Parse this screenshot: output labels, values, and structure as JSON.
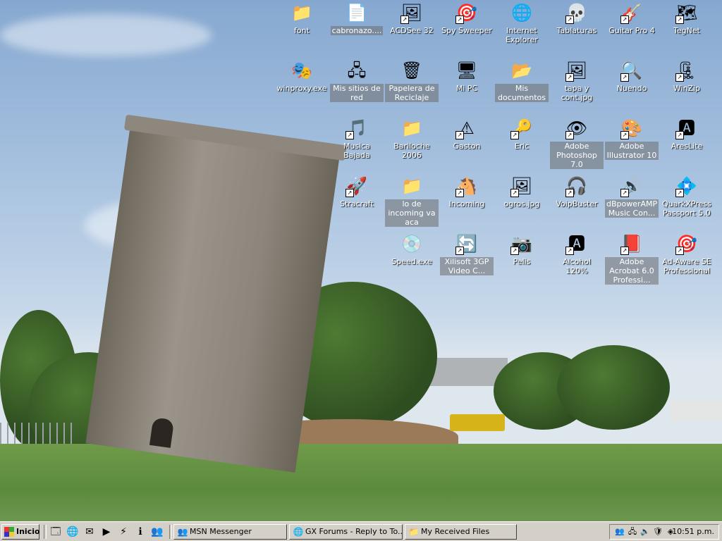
{
  "desktop": {
    "icons": [
      {
        "label": "font",
        "icon": "folder-icon",
        "glyph": "📁",
        "shortcut": false,
        "shaded": false
      },
      {
        "label": "cabronazo....",
        "icon": "document-icon",
        "glyph": "📄",
        "shortcut": false,
        "shaded": true
      },
      {
        "label": "ACDSee 32",
        "icon": "acdsee-icon",
        "glyph": "🖼",
        "shortcut": true,
        "shaded": false
      },
      {
        "label": "Spy Sweeper",
        "icon": "spy-sweeper-icon",
        "glyph": "🎯",
        "shortcut": true,
        "shaded": false
      },
      {
        "label": "Internet Explorer",
        "icon": "internet-explorer-icon",
        "glyph": "🌐",
        "shortcut": false,
        "shaded": false
      },
      {
        "label": "Tablaturas",
        "icon": "tablaturas-icon",
        "glyph": "💀",
        "shortcut": true,
        "shaded": false
      },
      {
        "label": "Guitar Pro 4",
        "icon": "guitar-pro-icon",
        "glyph": "🎸",
        "shortcut": true,
        "shaded": false
      },
      {
        "label": "TegNet",
        "icon": "tegnet-icon",
        "glyph": "🗺",
        "shortcut": true,
        "shaded": false
      },
      {
        "label": "winproxy.exe",
        "icon": "winproxy-icon",
        "glyph": "🎭",
        "shortcut": false,
        "shaded": false
      },
      {
        "label": "Mis sitios de red",
        "icon": "network-places-icon",
        "glyph": "🖧",
        "shortcut": false,
        "shaded": true
      },
      {
        "label": "Papelera de Reciclaje",
        "icon": "recycle-bin-icon",
        "glyph": "🗑",
        "shortcut": false,
        "shaded": true
      },
      {
        "label": "Mi PC",
        "icon": "my-computer-icon",
        "glyph": "🖥",
        "shortcut": false,
        "shaded": false
      },
      {
        "label": "Mis documentos",
        "icon": "my-documents-icon",
        "glyph": "📂",
        "shortcut": false,
        "shaded": true
      },
      {
        "label": "tapa y cont.jpg",
        "icon": "jpg-file-icon",
        "glyph": "🖼",
        "shortcut": true,
        "shaded": false
      },
      {
        "label": "Nuendo",
        "icon": "nuendo-icon",
        "glyph": "🔍",
        "shortcut": true,
        "shaded": false
      },
      {
        "label": "WinZip",
        "icon": "winzip-icon",
        "glyph": "🗜",
        "shortcut": true,
        "shaded": false
      },
      {
        "label": "Musica Bajada",
        "icon": "musica-bajada-icon",
        "glyph": "🎵",
        "shortcut": true,
        "shaded": false
      },
      {
        "label": "Bariloche 2006",
        "icon": "folder-icon",
        "glyph": "📁",
        "shortcut": false,
        "shaded": false
      },
      {
        "label": "Gaston",
        "icon": "warning-icon",
        "glyph": "⚠",
        "shortcut": true,
        "shaded": false
      },
      {
        "label": "Eric",
        "icon": "eric-icon",
        "glyph": "🔑",
        "shortcut": true,
        "shaded": false
      },
      {
        "label": "Adobe Photoshop 7.0",
        "icon": "photoshop-icon",
        "glyph": "👁",
        "shortcut": true,
        "shaded": true
      },
      {
        "label": "Adobe Illustrator 10",
        "icon": "illustrator-icon",
        "glyph": "🎨",
        "shortcut": true,
        "shaded": true
      },
      {
        "label": "AresLite",
        "icon": "areslite-icon",
        "glyph": "🅰",
        "shortcut": true,
        "shaded": false
      },
      {
        "label": "Stracraft",
        "icon": "starcraft-icon",
        "glyph": "🚀",
        "shortcut": true,
        "shaded": false
      },
      {
        "label": "lo de incoming va aca",
        "icon": "folder-icon",
        "glyph": "📁",
        "shortcut": false,
        "shaded": true
      },
      {
        "label": "Incoming",
        "icon": "incoming-icon",
        "glyph": "🐴",
        "shortcut": true,
        "shaded": false
      },
      {
        "label": "ogros.jpg",
        "icon": "jpg-file-icon",
        "glyph": "🖼",
        "shortcut": true,
        "shaded": false
      },
      {
        "label": "VoipBuster",
        "icon": "voipbuster-icon",
        "glyph": "🎧",
        "shortcut": true,
        "shaded": false
      },
      {
        "label": "dBpowerAMP Music Con...",
        "icon": "dbpoweramp-icon",
        "glyph": "🔊",
        "shortcut": true,
        "shaded": true
      },
      {
        "label": "QuarkXPress Passport 5.0",
        "icon": "quarkxpress-icon",
        "glyph": "💠",
        "shortcut": true,
        "shaded": false
      },
      {
        "label": "Speed.exe",
        "icon": "speed-exe-icon",
        "glyph": "💿",
        "shortcut": false,
        "shaded": false
      },
      {
        "label": "Xilisoft 3GP Video C...",
        "icon": "xilisoft-icon",
        "glyph": "🔄",
        "shortcut": true,
        "shaded": true
      },
      {
        "label": "Pelis",
        "icon": "pelis-icon",
        "glyph": "📷",
        "shortcut": true,
        "shaded": false
      },
      {
        "label": "Alcohol 120%",
        "icon": "alcohol-icon",
        "glyph": "🅰",
        "shortcut": true,
        "shaded": false
      },
      {
        "label": "Adobe Acrobat 6.0 Professi...",
        "icon": "acrobat-icon",
        "glyph": "📕",
        "shortcut": true,
        "shaded": true
      },
      {
        "label": "Ad-Aware SE Professional",
        "icon": "ad-aware-icon",
        "glyph": "🎯",
        "shortcut": true,
        "shaded": false
      }
    ]
  },
  "taskbar": {
    "start_label": "Inicio",
    "quick_launch": [
      {
        "icon": "show-desktop-icon",
        "glyph": "🗔"
      },
      {
        "icon": "internet-explorer-icon",
        "glyph": "🌐"
      },
      {
        "icon": "outlook-express-icon",
        "glyph": "✉"
      },
      {
        "icon": "media-player-icon",
        "glyph": "▶"
      },
      {
        "icon": "winamp-icon",
        "glyph": "⚡"
      },
      {
        "icon": "messenger-icon",
        "glyph": "ℹ"
      },
      {
        "icon": "msn-icon",
        "glyph": "👥"
      }
    ],
    "tasks": [
      {
        "label": "MSN Messenger",
        "icon": "msn-messenger-icon",
        "glyph": "👥"
      },
      {
        "label": "GX Forums - Reply to To...",
        "icon": "browser-window-icon",
        "glyph": "🌐"
      },
      {
        "label": "My Received Files",
        "icon": "folder-icon",
        "glyph": "📁"
      }
    ],
    "tray": {
      "icons": [
        {
          "icon": "msn-tray-icon",
          "glyph": "👥"
        },
        {
          "icon": "network-tray-icon",
          "glyph": "🖧"
        },
        {
          "icon": "speaker-tray-icon",
          "glyph": "🔈"
        },
        {
          "icon": "antivirus-tray-icon",
          "glyph": "🛡"
        },
        {
          "icon": "app-tray-icon",
          "glyph": "◈"
        }
      ],
      "clock": "10:51 p.m."
    }
  }
}
